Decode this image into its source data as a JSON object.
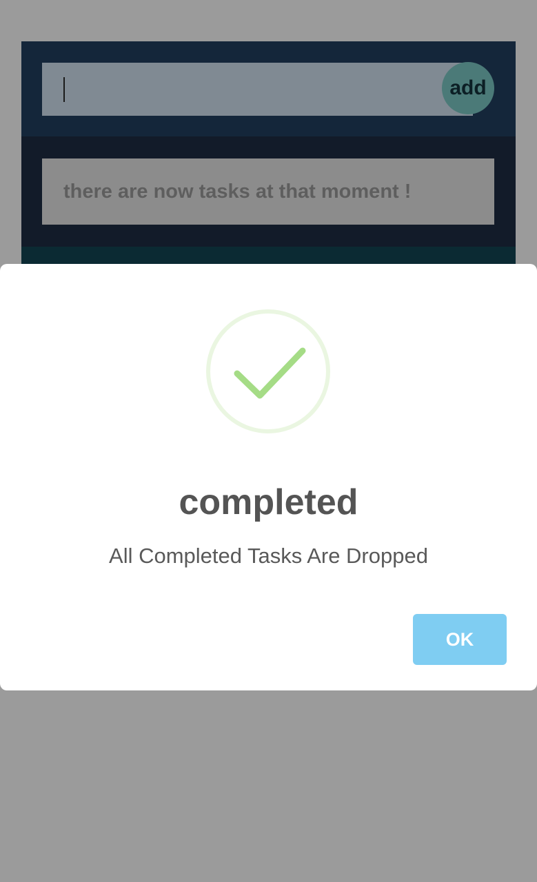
{
  "app": {
    "input": {
      "value": "",
      "placeholder": ""
    },
    "add_label": "add",
    "empty_message": "there are now tasks at that moment !"
  },
  "dialog": {
    "icon": "success-check-icon",
    "title": "completed",
    "message": "All Completed Tasks Are Dropped",
    "ok_label": "OK"
  },
  "colors": {
    "overlay": "#9b9b9b",
    "header_bg": "#14263a",
    "body_bg": "#121b29",
    "add_button": "#4b7a78",
    "check_green": "#a5dc86",
    "ring_green": "#eaf6e1",
    "ok_button": "#7fcdf2"
  }
}
